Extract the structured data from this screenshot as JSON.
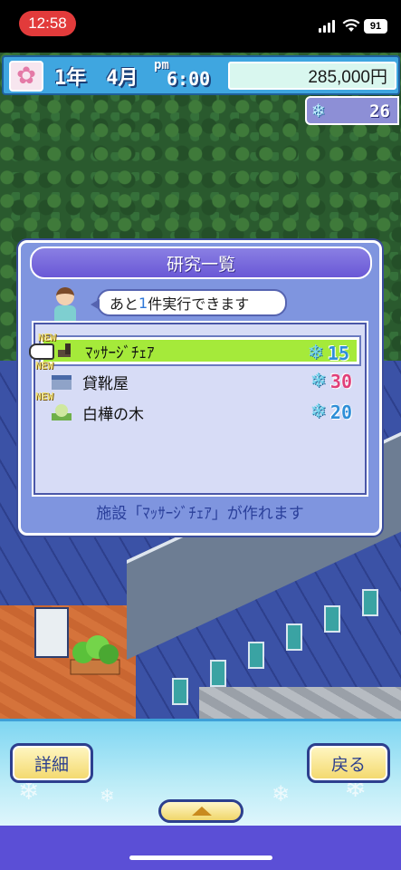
{
  "status": {
    "time": "12:58",
    "battery": "91"
  },
  "hud": {
    "year_label": "1年",
    "month_label": "4月",
    "ampm": "pm",
    "clock": "6:00",
    "money": "285,000円",
    "research_points": "26"
  },
  "dialog": {
    "title": "研究一覧",
    "speech_prefix": "あと",
    "speech_count": "1",
    "speech_suffix": "件実行できます",
    "new_tag": "NEW",
    "items": [
      {
        "name": "ﾏｯｻｰｼﾞﾁｪｱ",
        "cost": "15",
        "cost_color": "#2f8fd8",
        "selected": true
      },
      {
        "name": "貸靴屋",
        "cost": "30",
        "cost_color": "#e0407a",
        "selected": false
      },
      {
        "name": "白樺の木",
        "cost": "20",
        "cost_color": "#2f8fd8",
        "selected": false
      }
    ],
    "footer": "施設「ﾏｯｻｰｼﾞﾁｪｱ」が作れます"
  },
  "buttons": {
    "detail": "詳細",
    "back": "戻る"
  },
  "colors": {
    "accent": "#3fa6e0",
    "selected_row": "#a5ea3a",
    "dialog_bg": "#7f95df"
  }
}
